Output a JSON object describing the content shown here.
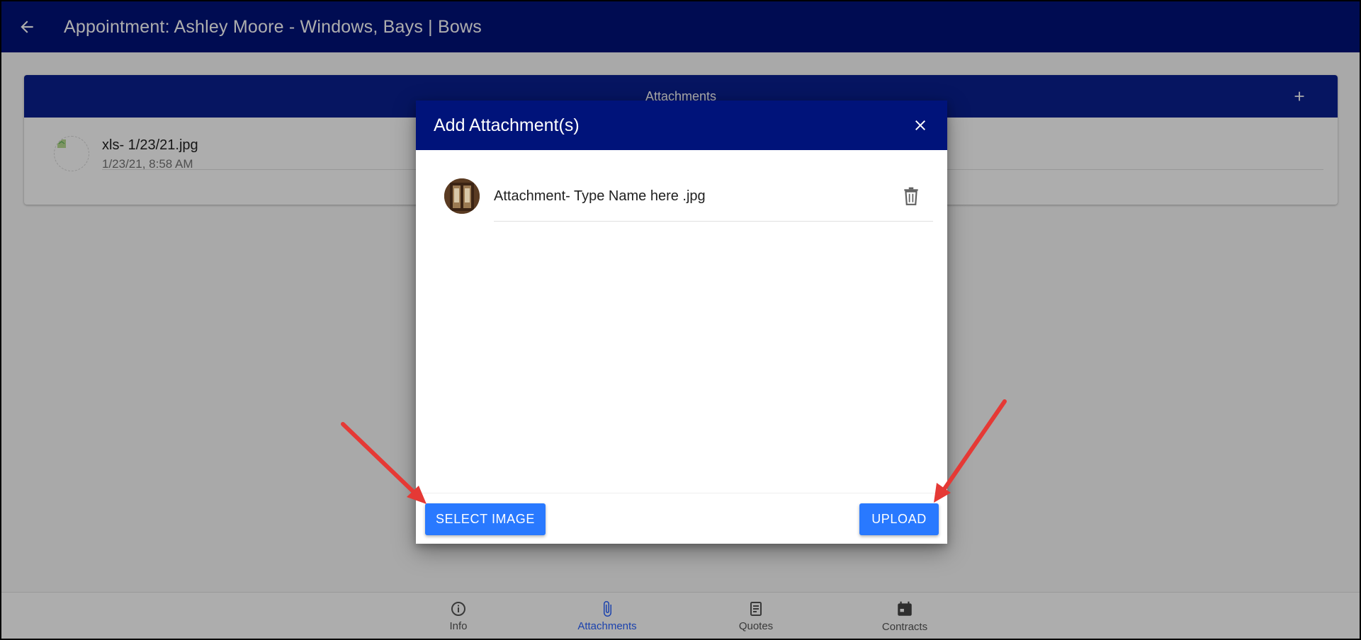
{
  "appbar": {
    "title": "Appointment: Ashley Moore - Windows, Bays | Bows",
    "back_icon": "arrow-back-icon"
  },
  "attachments_card": {
    "title": "Attachments",
    "add_icon": "plus-icon",
    "items": [
      {
        "name": "xls- 1/23/21.jpg",
        "date": "1/23/21, 8:58 AM"
      }
    ]
  },
  "dialog": {
    "title": "Add Attachment(s)",
    "close_icon": "close-icon",
    "items": [
      {
        "name": "Attachment- Type Name here .jpg",
        "delete_icon": "trash-icon"
      }
    ],
    "select_label": "SELECT IMAGE",
    "upload_label": "UPLOAD"
  },
  "bottom_nav": {
    "items": [
      {
        "label": "Info",
        "icon": "info-icon"
      },
      {
        "label": "Attachments",
        "icon": "paperclip-icon"
      },
      {
        "label": "Quotes",
        "icon": "document-icon"
      },
      {
        "label": "Contracts",
        "icon": "calendar-icon"
      }
    ],
    "active": "Attachments"
  },
  "colors": {
    "primary": "#00137a",
    "button": "#2979ff",
    "active_nav": "#2962ff",
    "annotation_arrow": "#e53935"
  }
}
